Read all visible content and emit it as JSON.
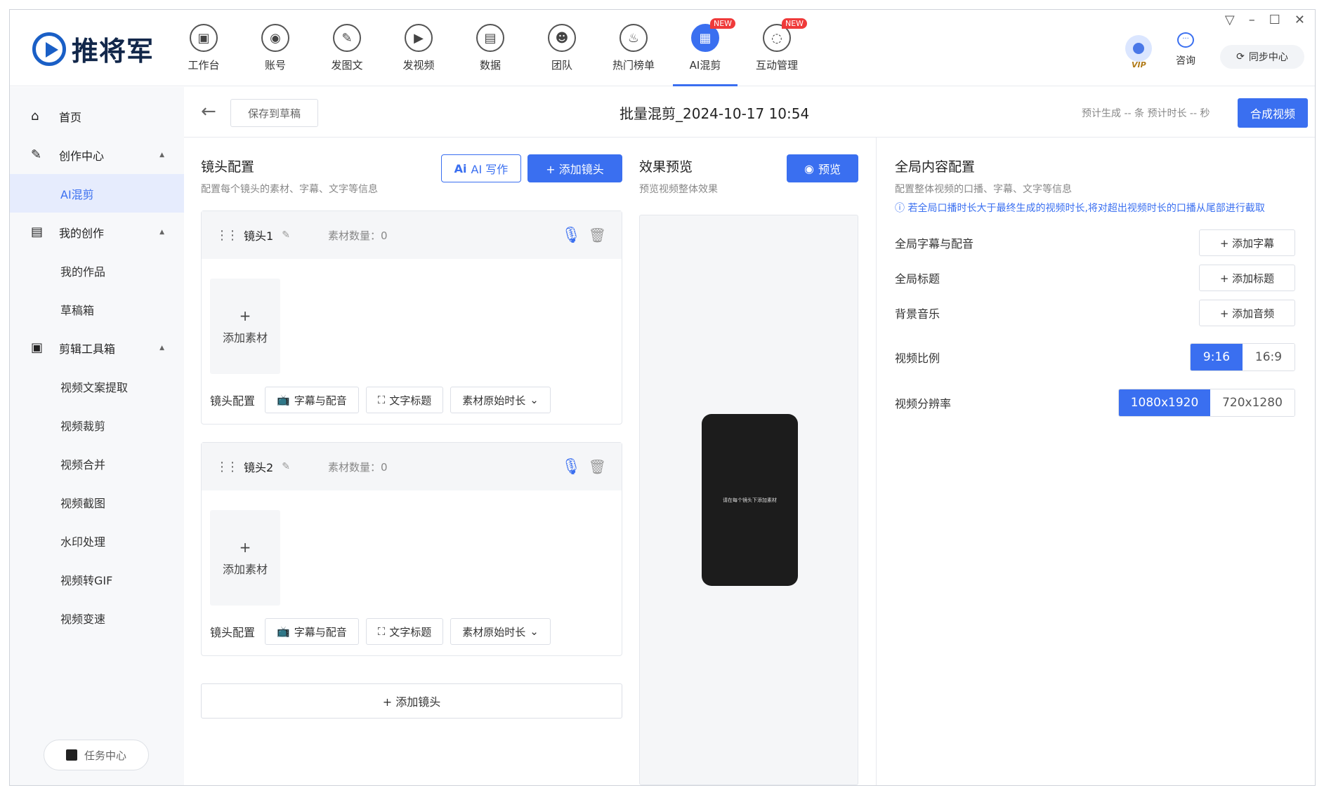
{
  "app": {
    "logo_text": "推将军"
  },
  "nav": [
    {
      "label": "工作台",
      "icon": "workbench-icon",
      "glyph": "▣"
    },
    {
      "label": "账号",
      "icon": "account-icon",
      "glyph": "◉"
    },
    {
      "label": "发图文",
      "icon": "post-article-icon",
      "glyph": "✎"
    },
    {
      "label": "发视频",
      "icon": "post-video-icon",
      "glyph": "▶"
    },
    {
      "label": "数据",
      "icon": "data-icon",
      "glyph": "▤"
    },
    {
      "label": "团队",
      "icon": "team-icon",
      "glyph": "☻"
    },
    {
      "label": "热门榜单",
      "icon": "hot-list-icon",
      "glyph": "♨"
    },
    {
      "label": "AI混剪",
      "icon": "ai-mix-icon",
      "glyph": "▦",
      "active": true,
      "badge": "NEW"
    },
    {
      "label": "互动管理",
      "icon": "interaction-icon",
      "glyph": "◌",
      "badge": "NEW"
    }
  ],
  "header_right": {
    "vip": "VIP",
    "consult": "咨询",
    "sync": "同步中心"
  },
  "sidebar": {
    "home": "首页",
    "creation_center": "创作中心",
    "ai_mix": "AI混剪",
    "my_creation": "我的创作",
    "my_works": "我的作品",
    "drafts": "草稿箱",
    "toolbox": "剪辑工具箱",
    "tools": [
      "视频文案提取",
      "视频裁剪",
      "视频合并",
      "视频截图",
      "水印处理",
      "视频转GIF",
      "视频变速"
    ],
    "task_center": "任务中心"
  },
  "subbar": {
    "save_draft": "保存到草稿",
    "title": "批量混剪_2024-10-17 10:54",
    "estimate": "预计生成 -- 条   预计时长 -- 秒",
    "compose": "合成视频"
  },
  "shots_panel": {
    "title": "镜头配置",
    "subtitle": "配置每个镜头的素材、字幕、文字等信息",
    "ai_write": "AI 写作",
    "add_shot": "+ 添加镜头",
    "shots": [
      {
        "name": "镜头1",
        "count": "素材数量：0"
      },
      {
        "name": "镜头2",
        "count": "素材数量：0"
      }
    ],
    "add_material": "添加素材",
    "cfg_label": "镜头配置",
    "subtitle_dub": "字幕与配音",
    "text_title": "文字标题",
    "duration": "素材原始时长",
    "add_shot_bottom": "+ 添加镜头"
  },
  "preview_panel": {
    "title": "效果预览",
    "subtitle": "预览视频整体效果",
    "button": "预览",
    "phone_text": "请在每个镜头下添加素材"
  },
  "global_panel": {
    "title": "全局内容配置",
    "subtitle": "配置整体视频的口播、字幕、文字等信息",
    "notice": "若全局口播时长大于最终生成的视频时长,将对超出视频时长的口播从尾部进行截取",
    "rows": [
      {
        "label": "全局字幕与配音",
        "button": "+ 添加字幕"
      },
      {
        "label": "全局标题",
        "button": "+ 添加标题"
      },
      {
        "label": "背景音乐",
        "button": "+ 添加音频"
      }
    ],
    "ratio_label": "视频比例",
    "ratio_options": [
      "9:16",
      "16:9"
    ],
    "ratio_selected": "9:16",
    "resolution_label": "视频分辨率",
    "resolution_options": [
      "1080x1920",
      "720x1280"
    ],
    "resolution_selected": "1080x1920"
  },
  "colors": {
    "accent": "#3a6ff0",
    "badge": "#ef3a3a"
  }
}
